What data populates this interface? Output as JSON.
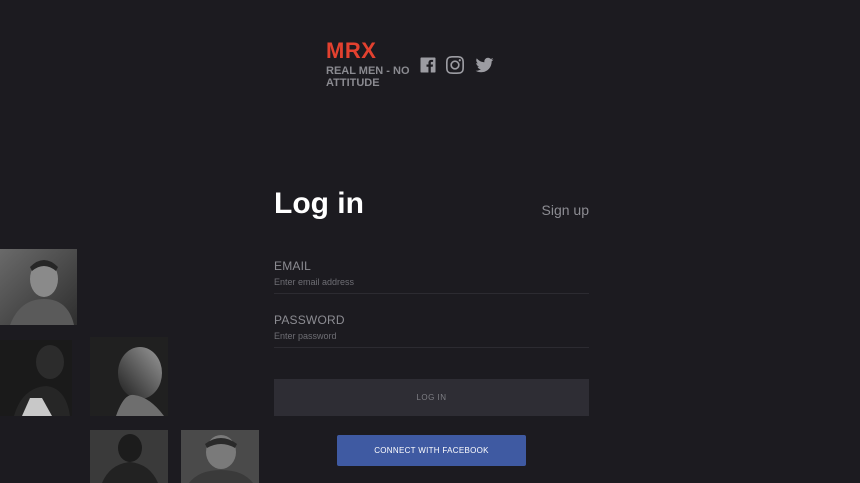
{
  "header": {
    "logo": "MRX",
    "tagline": "REAL MEN - NO ATTITUDE",
    "social": [
      "facebook-icon",
      "instagram-icon",
      "twitter-icon"
    ]
  },
  "form": {
    "title": "Log in",
    "signup_label": "Sign up",
    "email": {
      "label": "EMAIL",
      "placeholder": "Enter email address",
      "value": ""
    },
    "password": {
      "label": "PASSWORD",
      "placeholder": "Enter password",
      "value": ""
    },
    "login_label": "LOG IN",
    "facebook_label": "CONNECT WITH FACEBOOK"
  },
  "colors": {
    "background": "#1c1b20",
    "brand": "#e3412f",
    "facebook": "#3f5aa2",
    "button": "#2e2d34"
  },
  "photos": [
    "portrait-photo-1",
    "portrait-photo-2",
    "portrait-photo-3",
    "portrait-photo-4",
    "portrait-photo-5"
  ]
}
